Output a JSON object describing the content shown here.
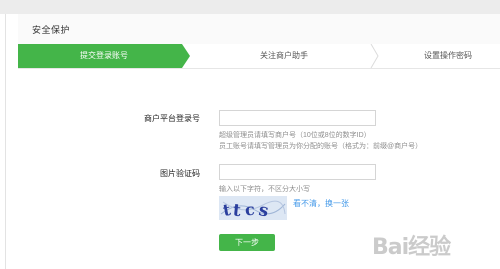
{
  "header": {
    "title": "安全保护"
  },
  "steps": [
    {
      "label": "提交登录账号",
      "active": true
    },
    {
      "label": "关注商户助手",
      "active": false
    },
    {
      "label": "设置操作密码",
      "active": false
    }
  ],
  "form": {
    "account_label": "商户平台登录号",
    "account_value": "",
    "account_hints": [
      "超级管理员请填写商户号（10位或8位的数字ID）",
      "员工账号请填写管理员为你分配的账号（格式为：前缀@商户号）"
    ],
    "captcha_label": "图片验证码",
    "captcha_value": "",
    "captcha_hint": "输入以下字符，不区分大小写",
    "captcha_refresh": "看不清，换一张",
    "next_button": "下一步"
  },
  "colors": {
    "accent": "#44b549",
    "link": "#459ae9",
    "hint": "#8d8d8d"
  },
  "watermark": "Bai经验"
}
